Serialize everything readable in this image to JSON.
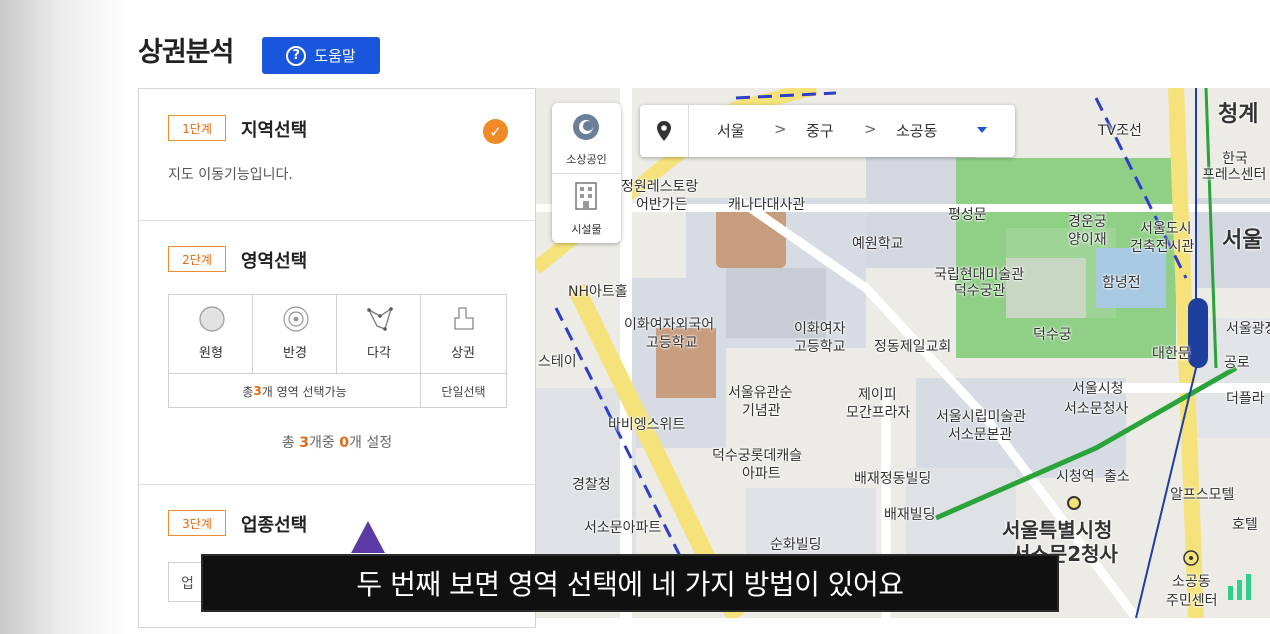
{
  "header": {
    "title": "상권분석",
    "help_label": "도움말",
    "help_icon": "?"
  },
  "steps": {
    "step1": {
      "badge": "1단계",
      "title": "지역선택",
      "description": "지도 이동기능입니다.",
      "completed": true
    },
    "step2": {
      "badge": "2단계",
      "title": "영역선택",
      "tools": [
        {
          "label": "원형",
          "icon": "circle-icon"
        },
        {
          "label": "반경",
          "icon": "radius-icon"
        },
        {
          "label": "다각",
          "icon": "polygon-icon"
        },
        {
          "label": "상권",
          "icon": "district-icon"
        }
      ],
      "multi_select": {
        "prefix": "총 ",
        "count": "3",
        "suffix": "개 영역 선택가능"
      },
      "single_select": "단일선택",
      "total": {
        "prefix": "총 ",
        "count": "3",
        "middle": "개중 ",
        "set": "0",
        "suffix": "개 설정"
      }
    },
    "step3": {
      "badge": "3단계",
      "title": "업종선택",
      "input_text": "업"
    }
  },
  "map": {
    "widget": {
      "item1": "소상공인",
      "item2": "시설물"
    },
    "location": {
      "city": "서울",
      "district": "중구",
      "dong": "소공동",
      "separator": ">"
    },
    "labels": {
      "l1": "정원레스토랑",
      "l2": "어반가든",
      "l3": "캐나다대사관",
      "l4": "예원학교",
      "l5": "평성문",
      "l6": "경운궁",
      "l7": "양이재",
      "l8": "서울도시",
      "l9": "건축전시관",
      "l10": "국립현대미술관",
      "l11": "덕수궁관",
      "l12": "함녕전",
      "l13": "덕수궁",
      "l14": "대한문",
      "l15": "NH아트홀",
      "l16": "이화여자외국어",
      "l17": "고등학교",
      "l18": "이화여자",
      "l19": "고등학교",
      "l20": "정동제일교회",
      "l21": "서울유관순",
      "l22": "기념관",
      "l23": "제이피",
      "l24": "모간프라자",
      "l25": "서울시립미술관",
      "l26": "서소문본관",
      "l27": "서울시청",
      "l28": "서소문청사",
      "l29": "바비엥스위트",
      "l30": "덕수궁롯데캐슬",
      "l31": "아파트",
      "l32": "배재정동빌딩",
      "l33": "경찰청",
      "l34": "배재빌딩",
      "l35": "서소문아파트",
      "l36": "순화빌딩",
      "l37": "서울특별시청",
      "l38": "서소문2청사",
      "l39": "소공동",
      "l40": "주민센터",
      "l41": "청계",
      "l42": "한국",
      "l43": "프레스센터",
      "l44": "서울",
      "l45": "TV조선",
      "l46": "알프스모텔",
      "l47": "호텔",
      "l48": "더플라",
      "l49": "서울광장",
      "l50": "스테이",
      "l51": "시청역",
      "l52": "시청역",
      "l53": "공로",
      "l54": "출소",
      "l55": "서울특별시"
    }
  },
  "subtitle": "두 번째 보면  영역 선택에 네 가지 방법이 있어요",
  "colors": {
    "accent": "#1a56db",
    "orange": "#e26b10",
    "park": "#8fcf86",
    "subway_green": "#2aa33b",
    "subway_blue": "#1f3f9e"
  }
}
